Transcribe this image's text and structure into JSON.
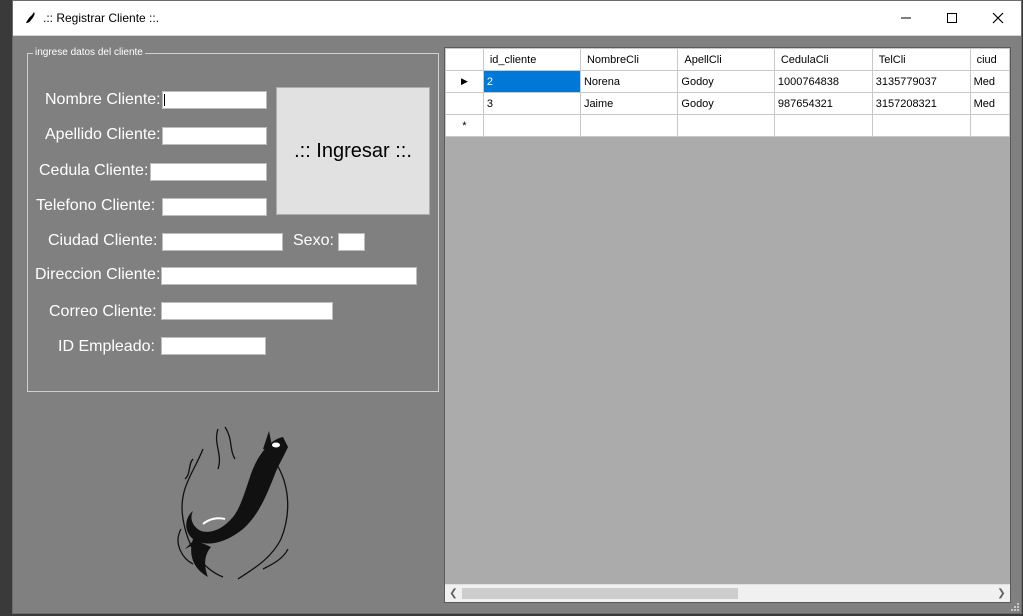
{
  "window": {
    "title": ".:: Registrar Cliente ::.",
    "icon": "orca-icon",
    "controls": [
      "minimize-icon",
      "maximize-icon",
      "close-icon"
    ]
  },
  "form": {
    "group_title": "ingrese datos del cliente",
    "labels": {
      "nombre": "Nombre Cliente:",
      "apellido": "Apellido Cliente:",
      "cedula": "Cedula Cliente:",
      "telefono": "Telefono Cliente:",
      "ciudad": "Ciudad Cliente:",
      "sexo": "Sexo:",
      "direccion": "Direccion Cliente:",
      "correo": "Correo Cliente:",
      "empleado": "ID Empleado:"
    },
    "values": {
      "nombre": "",
      "apellido": "",
      "cedula": "",
      "telefono": "",
      "ciudad": "",
      "sexo": "",
      "direccion": "",
      "correo": "",
      "empleado": ""
    },
    "submit_label": ".:: Ingresar ::."
  },
  "grid": {
    "columns": [
      "id_cliente",
      "NombreCli",
      "ApellCli",
      "CedulaCli",
      "TelCli",
      "ciud"
    ],
    "rows": [
      [
        "2",
        "Norena",
        "Godoy",
        "1000764838",
        "3135779037",
        "Med"
      ],
      [
        "3",
        "Jaime",
        "Godoy",
        "987654321",
        "3157208321",
        "Med"
      ]
    ],
    "current_row_marker": "▶",
    "new_row_marker": "*",
    "selected_cell": "id_cliente of row 1"
  }
}
